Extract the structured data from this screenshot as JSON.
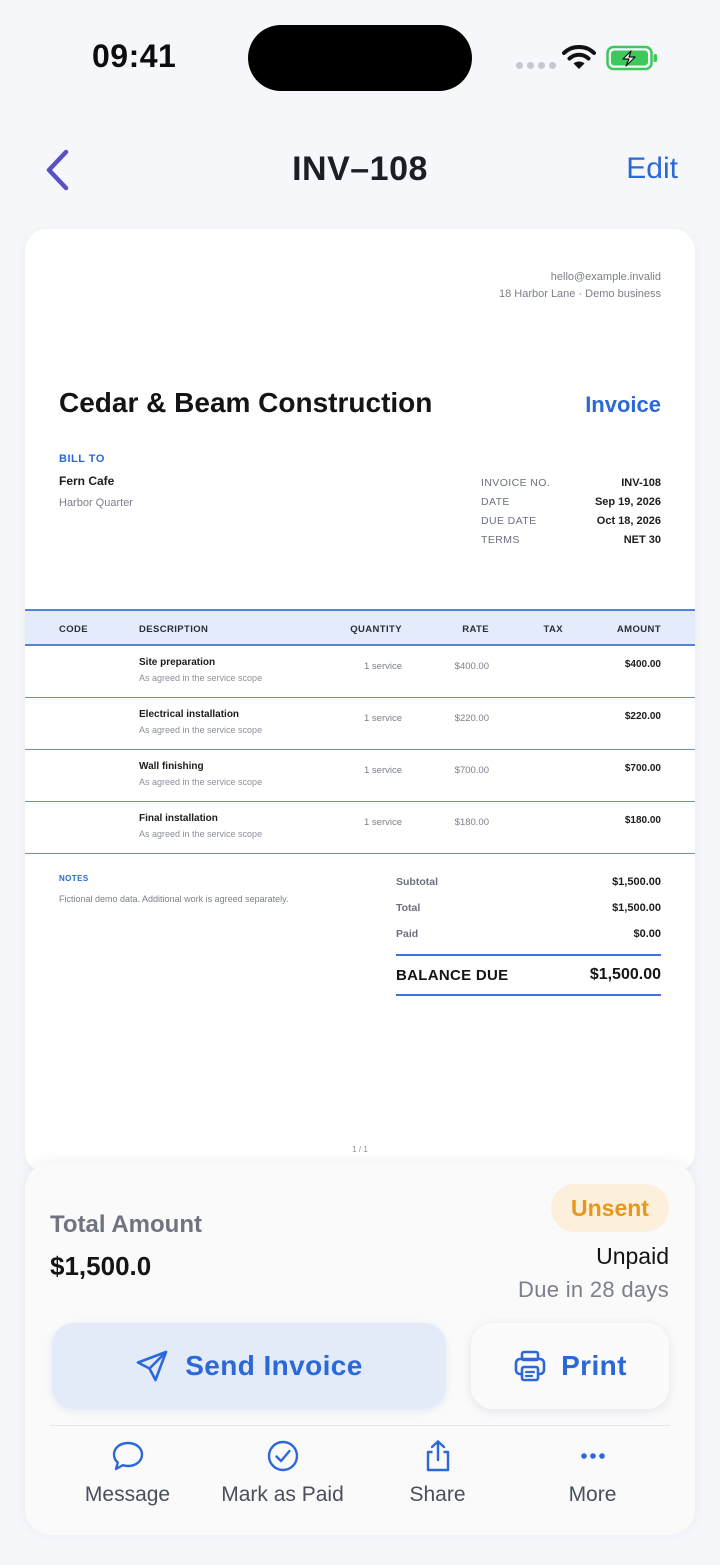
{
  "status_bar": {
    "time": "09:41"
  },
  "nav": {
    "title": "INV–108",
    "edit_label": "Edit"
  },
  "invoice": {
    "contact_email": "hello@example.invalid",
    "contact_address": "18 Harbor Lane · Demo business",
    "company": "Cedar & Beam Construction",
    "doc_type": "Invoice",
    "bill_to_label": "BILL TO",
    "bill_to_name": "Fern Cafe",
    "bill_to_address": "Harbor Quarter",
    "meta": [
      {
        "label": "INVOICE NO.",
        "value": "INV-108"
      },
      {
        "label": "DATE",
        "value": "Sep 19, 2026"
      },
      {
        "label": "DUE DATE",
        "value": "Oct 18, 2026"
      },
      {
        "label": "TERMS",
        "value": "NET 30"
      }
    ],
    "columns": {
      "code": "CODE",
      "description": "DESCRIPTION",
      "quantity": "QUANTITY",
      "rate": "RATE",
      "tax": "TAX",
      "amount": "AMOUNT"
    },
    "items": [
      {
        "name": "Site preparation",
        "note": "As agreed in the service scope",
        "qty": "1 service",
        "rate": "$400.00",
        "amount": "$400.00"
      },
      {
        "name": "Electrical installation",
        "note": "As agreed in the service scope",
        "qty": "1 service",
        "rate": "$220.00",
        "amount": "$220.00"
      },
      {
        "name": "Wall finishing",
        "note": "As agreed in the service scope",
        "qty": "1 service",
        "rate": "$700.00",
        "amount": "$700.00"
      },
      {
        "name": "Final installation",
        "note": "As agreed in the service scope",
        "qty": "1 service",
        "rate": "$180.00",
        "amount": "$180.00"
      }
    ],
    "notes_label": "NOTES",
    "notes_text": "Fictional demo data. Additional work is agreed separately.",
    "totals": [
      {
        "label": "Subtotal",
        "value": "$1,500.00"
      },
      {
        "label": "Total",
        "value": "$1,500.00"
      },
      {
        "label": "Paid",
        "value": "$0.00"
      }
    ],
    "balance_label": "BALANCE DUE",
    "balance_value": "$1,500.00",
    "page": "1 / 1"
  },
  "summary": {
    "total_label": "Total Amount",
    "total_value": "$1,500.0",
    "status_badge": "Unsent",
    "payment_status": "Unpaid",
    "due_text": "Due in 28 days",
    "send_label": "Send Invoice",
    "print_label": "Print"
  },
  "actions": [
    {
      "label": "Message",
      "icon": "message-icon"
    },
    {
      "label": "Mark as Paid",
      "icon": "check-circle-icon"
    },
    {
      "label": "Share",
      "icon": "share-icon"
    },
    {
      "label": "More",
      "icon": "more-icon"
    }
  ],
  "colors": {
    "accent": "#2b68d8",
    "back_chevron": "#5b4fc4",
    "badge_bg": "#fcefdc",
    "badge_text": "#e8971a",
    "battery": "#3cc85a"
  }
}
